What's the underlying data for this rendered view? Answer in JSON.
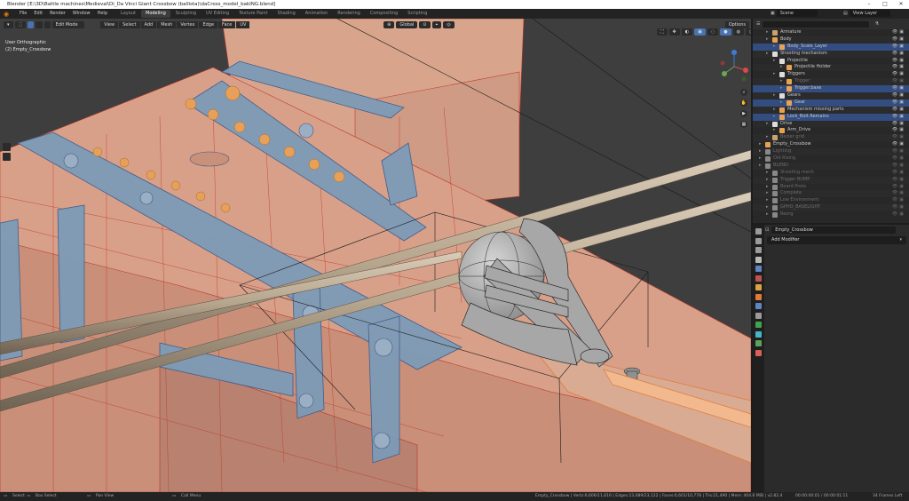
{
  "window": {
    "title": "Blender [E:\\3D\\Battle machines\\Medieval\\Di_Da Vinci Giant Crossbow (ballista)\\daCross_model_bakING.blend]",
    "minimize_icon": "minimize-icon",
    "maximize_icon": "maximize-icon",
    "close_icon": "close-icon"
  },
  "menubar": {
    "menus": [
      "File",
      "Edit",
      "Render",
      "Window",
      "Help"
    ],
    "workspaces": [
      "Layout",
      "Modeling",
      "Sculpting",
      "UV Editing",
      "Texture Paint",
      "Shading",
      "Animation",
      "Rendering",
      "Compositing",
      "Scripting"
    ],
    "active_workspace": "Modeling",
    "scene_label": "Scene",
    "view_layer_label": "View Layer"
  },
  "viewport": {
    "mode": "Edit Mode",
    "menus": [
      "View",
      "Select",
      "Add",
      "Mesh",
      "Vertex",
      "Edge",
      "Face",
      "UV"
    ],
    "transform_orientation": "Global",
    "options_label": "Options",
    "view_name": "User Orthographic",
    "object_name": "(2) Empty_Crossbow"
  },
  "outliner": {
    "rows": [
      {
        "label": "Armature",
        "indent": 2,
        "icon": "armature-icon",
        "color": "#c8a46c",
        "selected": false,
        "dim": false
      },
      {
        "label": "Body",
        "indent": 2,
        "icon": "mesh-icon",
        "color": "#e8a352",
        "selected": false,
        "dim": false
      },
      {
        "label": "Body_Scale_Layer",
        "indent": 3,
        "icon": "mesh-icon",
        "color": "#e8a352",
        "selected": true,
        "dim": false
      },
      {
        "label": "Shooting mechanism",
        "indent": 2,
        "icon": "collection-icon",
        "color": "#dddddd",
        "selected": false,
        "dim": false
      },
      {
        "label": "Projectile",
        "indent": 3,
        "icon": "collection-icon",
        "color": "#dddddd",
        "selected": false,
        "dim": false
      },
      {
        "label": "Projectile Holder",
        "indent": 4,
        "icon": "mesh-icon",
        "color": "#e8a352",
        "selected": false,
        "dim": false
      },
      {
        "label": "Triggers",
        "indent": 3,
        "icon": "collection-icon",
        "color": "#dddddd",
        "selected": false,
        "dim": false
      },
      {
        "label": "Trigger",
        "indent": 4,
        "icon": "mesh-icon",
        "color": "#e8a352",
        "selected": false,
        "dim": true
      },
      {
        "label": "Trigger.base",
        "indent": 4,
        "icon": "mesh-icon",
        "color": "#e8a352",
        "selected": true,
        "dim": false
      },
      {
        "label": "Gears",
        "indent": 3,
        "icon": "collection-icon",
        "color": "#dddddd",
        "selected": false,
        "dim": false
      },
      {
        "label": "Gear",
        "indent": 4,
        "icon": "mesh-icon",
        "color": "#e8a352",
        "selected": true,
        "dim": false
      },
      {
        "label": "Mechanism missing parts",
        "indent": 3,
        "icon": "mesh-icon",
        "color": "#e8a352",
        "selected": false,
        "dim": false
      },
      {
        "label": "Lock_Bolt.Remains",
        "indent": 3,
        "icon": "mesh-icon",
        "color": "#e8a352",
        "selected": true,
        "dim": false
      },
      {
        "label": "Drive",
        "indent": 2,
        "icon": "collection-icon",
        "color": "#dddddd",
        "selected": false,
        "dim": false
      },
      {
        "label": "Arm_Drive",
        "indent": 3,
        "icon": "mesh-icon",
        "color": "#e8a352",
        "selected": false,
        "dim": false
      },
      {
        "label": "Bezier grid",
        "indent": 2,
        "icon": "curve-icon",
        "color": "#c8a46c",
        "selected": false,
        "dim": true
      },
      {
        "label": "Empty_Crossbow",
        "indent": 1,
        "icon": "empty-icon",
        "color": "#e8a352",
        "selected": false,
        "dim": false
      },
      {
        "label": "Lighting",
        "indent": 1,
        "icon": "collection-icon",
        "color": "#888888",
        "selected": false,
        "dim": true
      },
      {
        "label": "Old Rising",
        "indent": 1,
        "icon": "collection-icon",
        "color": "#888888",
        "selected": false,
        "dim": true
      },
      {
        "label": "BLEND",
        "indent": 1,
        "icon": "collection-icon",
        "color": "#888888",
        "selected": false,
        "dim": true
      },
      {
        "label": "Shooting mech",
        "indent": 2,
        "icon": "mesh-icon",
        "color": "#888888",
        "selected": false,
        "dim": true
      },
      {
        "label": "Trigger BUMP",
        "indent": 2,
        "icon": "mesh-icon",
        "color": "#888888",
        "selected": false,
        "dim": true
      },
      {
        "label": "Board Proto",
        "indent": 2,
        "icon": "mesh-icon",
        "color": "#888888",
        "selected": false,
        "dim": true
      },
      {
        "label": "Complete",
        "indent": 2,
        "icon": "mesh-icon",
        "color": "#888888",
        "selected": false,
        "dim": true
      },
      {
        "label": "Low Environment",
        "indent": 2,
        "icon": "mesh-icon",
        "color": "#888888",
        "selected": false,
        "dim": true
      },
      {
        "label": "GPHO_BASELIGHT",
        "indent": 2,
        "icon": "mesh-icon",
        "color": "#888888",
        "selected": false,
        "dim": true
      },
      {
        "label": "Reorg",
        "indent": 2,
        "icon": "mesh-icon",
        "color": "#888888",
        "selected": false,
        "dim": true
      }
    ]
  },
  "properties": {
    "object_name": "Empty_Crossbow",
    "add_modifier": "Add Modifier",
    "tab_colors": [
      "#9a9a9a",
      "#9a9a9a",
      "#9a9a9a",
      "#b9b9b9",
      "#5e87c2",
      "#c05252",
      "#d9a441",
      "#e07a3b",
      "#5e87c2",
      "#9a9a9a",
      "#3fa34d",
      "#45b6c9",
      "#5aa35a",
      "#d95f5f"
    ]
  },
  "statusbar": {
    "select": "Select",
    "box_select": "Box Select",
    "pan_view": "Pan View",
    "call_menu": "Call Menu",
    "stats": "Empty_Crossbow | Verts:6,606/11,616 | Edges:13,089/23,122 | Faces:6,601/10,778 | Tris:21,490 | Mem: 404.6 MiB | v2.82.4",
    "frames": "00:00:00:01 / 00:00:01:11",
    "frames_label": "34 Frames Left"
  },
  "accent": "#4772b3",
  "orange_accent": "#e87d0d"
}
